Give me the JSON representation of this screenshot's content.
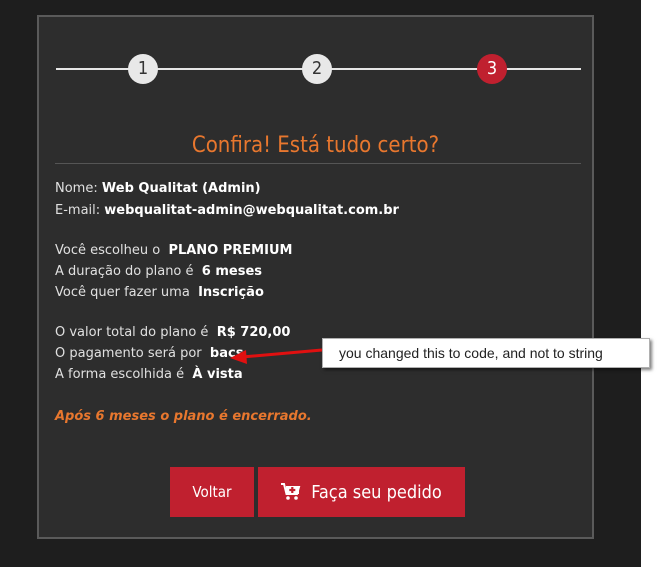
{
  "steps": [
    {
      "label": "1"
    },
    {
      "label": "2"
    },
    {
      "label": "3"
    }
  ],
  "title": "Confira! Está tudo certo?",
  "customer": {
    "name_label": "Nome:",
    "name_value": "Web Qualitat (Admin)",
    "email_label": "E-mail:",
    "email_value": "webqualitat-admin@webqualitat.com.br"
  },
  "plan": {
    "choice_label": "Você escolheu o",
    "choice_value": "PLANO PREMIUM",
    "duration_label": "A duração do plano é",
    "duration_value": "6 meses",
    "action_label": "Você quer fazer uma",
    "action_value": "Inscrição"
  },
  "payment": {
    "total_label": "O valor total do plano é",
    "total_value": "R$ 720,00",
    "method_label": "O pagamento será por",
    "method_value": "bacs",
    "form_label": "A forma escolhida é",
    "form_value": "À vista"
  },
  "note": "Após 6 meses o plano é encerrado.",
  "buttons": {
    "back": "Voltar",
    "order": "Faça seu pedido"
  },
  "annotation": "you changed this to code, and not to string",
  "colors": {
    "accent": "#c0202f",
    "title": "#e8772e",
    "panel": "#2d2d2d"
  }
}
